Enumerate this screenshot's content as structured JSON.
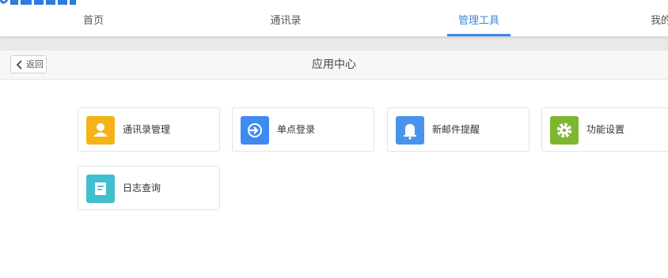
{
  "top_nav": {
    "tabs": [
      {
        "label": "首页",
        "active": false
      },
      {
        "label": "通讯录",
        "active": false
      },
      {
        "label": "管理工具",
        "active": true
      },
      {
        "label": "我的",
        "active": false
      }
    ]
  },
  "sub_header": {
    "back_label": "返回",
    "title": "应用中心"
  },
  "apps": [
    {
      "label": "通讯录管理",
      "icon": "user-icon",
      "color": "#f5b316"
    },
    {
      "label": "单点登录",
      "icon": "sign-in-icon",
      "color": "#3d8bf2"
    },
    {
      "label": "新邮件提醒",
      "icon": "bell-icon",
      "color": "#4a93ec"
    },
    {
      "label": "功能设置",
      "icon": "gear-icon",
      "color": "#7db72f"
    },
    {
      "label": "日志查询",
      "icon": "log-document-icon",
      "color": "#3fbfd0"
    }
  ],
  "colors": {
    "accent": "#3c86e0",
    "page_background": "#ffffff",
    "band": "#e9e9e9"
  }
}
